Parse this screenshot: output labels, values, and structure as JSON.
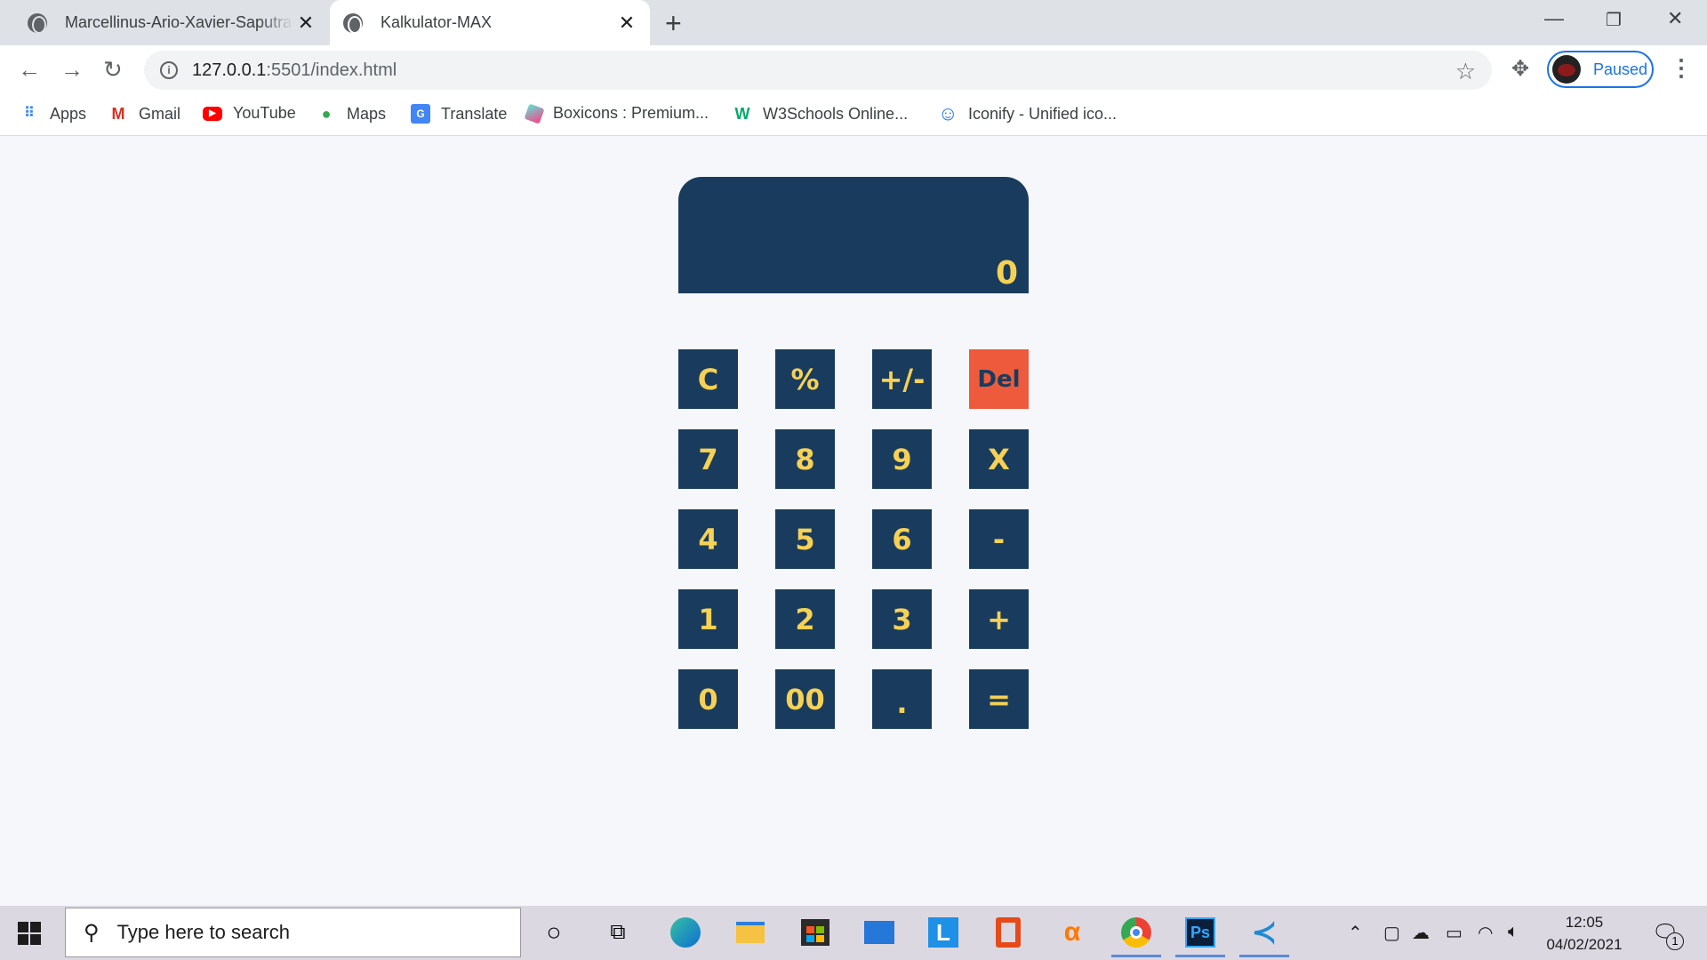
{
  "browser": {
    "tabs": [
      {
        "title": "Marcellinus-Ario-Xavier-Saputra",
        "active": false
      },
      {
        "title": "Kalkulator-MAX",
        "active": true
      }
    ],
    "url_host": "127.0.0.1",
    "url_path": ":5501/index.html",
    "profile_label": "Paused",
    "bookmarks": [
      "Apps",
      "Gmail",
      "YouTube",
      "Maps",
      "Translate",
      "Boxicons : Premium...",
      "W3Schools Online...",
      "Iconify - Unified ico..."
    ]
  },
  "calculator": {
    "display": "0",
    "keys": [
      [
        "C",
        "%",
        "+/-",
        "Del"
      ],
      [
        "7",
        "8",
        "9",
        "X"
      ],
      [
        "4",
        "5",
        "6",
        "-"
      ],
      [
        "1",
        "2",
        "3",
        "+"
      ],
      [
        "0",
        "00",
        ".",
        "="
      ]
    ],
    "colors": {
      "key_bg": "#193c5e",
      "key_text": "#f7d154",
      "delete_bg": "#ee5a3c"
    }
  },
  "taskbar": {
    "search_placeholder": "Type here to search",
    "time": "12:05",
    "date": "04/02/2021",
    "notification_count": "1"
  }
}
